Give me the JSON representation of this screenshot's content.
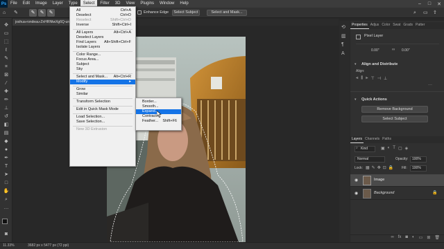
{
  "menubar": {
    "logo": "Ps",
    "items": [
      "File",
      "Edit",
      "Image",
      "Layer",
      "Type",
      "Select",
      "Filter",
      "3D",
      "View",
      "Plugins",
      "Window",
      "Help"
    ]
  },
  "options_bar": {
    "enhance_edge": "Enhance Edge",
    "select_subject": "Select Subject",
    "select_and_mask": "Select and Mask..."
  },
  "document": {
    "tab_title": "joshua-rondeau-ZnHRNtwXg6Q-unspl..."
  },
  "select_menu": {
    "items": [
      {
        "label": "All",
        "shortcut": "Ctrl+A"
      },
      {
        "label": "Deselect",
        "shortcut": "Ctrl+D"
      },
      {
        "label": "Reselect",
        "shortcut": "Shift+Ctrl+D",
        "disabled": true
      },
      {
        "label": "Inverse",
        "shortcut": "Shift+Ctrl+I"
      },
      {
        "sep": true
      },
      {
        "label": "All Layers",
        "shortcut": "Alt+Ctrl+A"
      },
      {
        "label": "Deselect Layers",
        "shortcut": ""
      },
      {
        "label": "Find Layers",
        "shortcut": "Alt+Shift+Ctrl+F"
      },
      {
        "label": "Isolate Layers",
        "shortcut": ""
      },
      {
        "sep": true
      },
      {
        "label": "Color Range...",
        "shortcut": ""
      },
      {
        "label": "Focus Area...",
        "shortcut": ""
      },
      {
        "label": "Subject",
        "shortcut": ""
      },
      {
        "label": "Sky",
        "shortcut": ""
      },
      {
        "sep": true
      },
      {
        "label": "Select and Mask...",
        "shortcut": "Alt+Ctrl+R"
      },
      {
        "label": "Modify",
        "shortcut": "",
        "submenu": true,
        "highlight": true
      },
      {
        "sep": true
      },
      {
        "label": "Grow",
        "shortcut": ""
      },
      {
        "label": "Similar",
        "shortcut": ""
      },
      {
        "sep": true
      },
      {
        "label": "Transform Selection",
        "shortcut": ""
      },
      {
        "sep": true
      },
      {
        "label": "Edit in Quick Mask Mode",
        "shortcut": ""
      },
      {
        "sep": true
      },
      {
        "label": "Load Selection...",
        "shortcut": ""
      },
      {
        "label": "Save Selection...",
        "shortcut": ""
      },
      {
        "sep": true
      },
      {
        "label": "New 3D Extrusion",
        "shortcut": "",
        "disabled": true
      }
    ]
  },
  "modify_submenu": {
    "items": [
      {
        "label": "Border...",
        "shortcut": ""
      },
      {
        "label": "Smooth...",
        "shortcut": ""
      },
      {
        "label": "Expand...",
        "shortcut": "",
        "highlight": true
      },
      {
        "label": "Contract...",
        "shortcut": ""
      },
      {
        "label": "Feather...",
        "shortcut": "Shift+F6"
      }
    ]
  },
  "properties_panel": {
    "tabs": [
      "Properties",
      "Adjus",
      "Color",
      "Swat",
      "Grads",
      "Patter"
    ],
    "layer_type": "Pixel Layer",
    "x_value": "0.00\"",
    "y_value": "0.00\"",
    "align_title": "Align and Distribute",
    "align_label": "Align:",
    "quick_actions_title": "Quick Actions",
    "remove_background": "Remove Background",
    "select_subject": "Select Subject"
  },
  "layers_panel": {
    "tabs": [
      "Layers",
      "Channels",
      "Paths"
    ],
    "filter_kind": "Kind",
    "blend_mode": "Normal",
    "opacity_label": "Opacity:",
    "opacity_value": "100%",
    "lock_label": "Lock:",
    "fill_label": "Fill:",
    "fill_value": "100%",
    "layers": [
      {
        "name": "Image",
        "selected": true,
        "locked": false
      },
      {
        "name": "Background",
        "selected": false,
        "locked": true
      }
    ]
  },
  "status_bar": {
    "zoom": "11.33%",
    "doc_size": "3682 px x 5477 px (72 ppi)"
  },
  "colors": {
    "accent": "#1473e6",
    "app_bg": "#282828"
  }
}
